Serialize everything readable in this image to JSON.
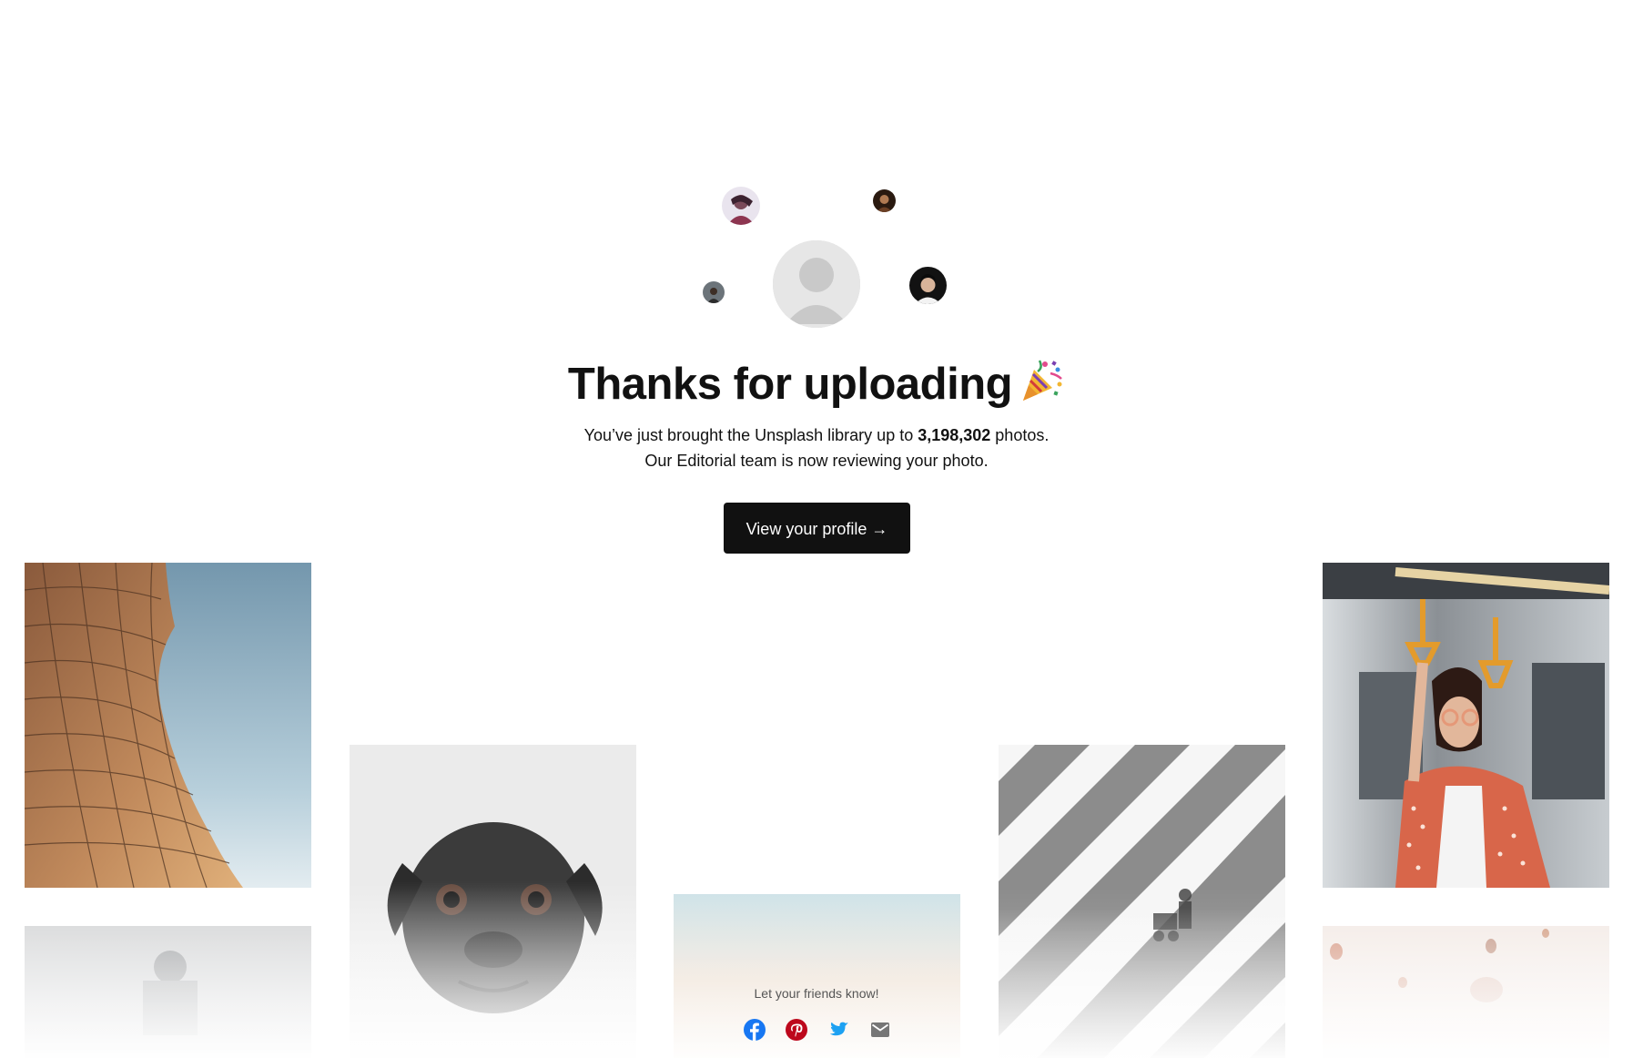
{
  "header": {
    "title": "Thanks for uploading",
    "title_icon": "party-popper-icon"
  },
  "message": {
    "line1_prefix": "You’ve just brought the Unsplash library up to ",
    "photo_count": "3,198,302",
    "line1_suffix": " photos.",
    "line2": "Our Editorial team is now reviewing your photo."
  },
  "cta": {
    "label": "View your profile →"
  },
  "avatars": [
    "user-avatar-placeholder",
    "contributor-avatar-1",
    "contributor-avatar-2",
    "contributor-avatar-3",
    "contributor-avatar-4"
  ],
  "gallery": [
    "building-photo",
    "pug-photo",
    "sky-photo",
    "crosswalk-photo",
    "woman-on-train-photo",
    "hiker-photo",
    "balloons-photo"
  ],
  "share": {
    "label": "Let your friends know!",
    "buttons": [
      {
        "name": "facebook",
        "icon": "facebook-icon",
        "color": "#1877F2"
      },
      {
        "name": "pinterest",
        "icon": "pinterest-icon",
        "color": "#BD081C"
      },
      {
        "name": "twitter",
        "icon": "twitter-icon",
        "color": "#1DA1F2"
      },
      {
        "name": "email",
        "icon": "email-icon",
        "color": "#767676"
      }
    ]
  }
}
